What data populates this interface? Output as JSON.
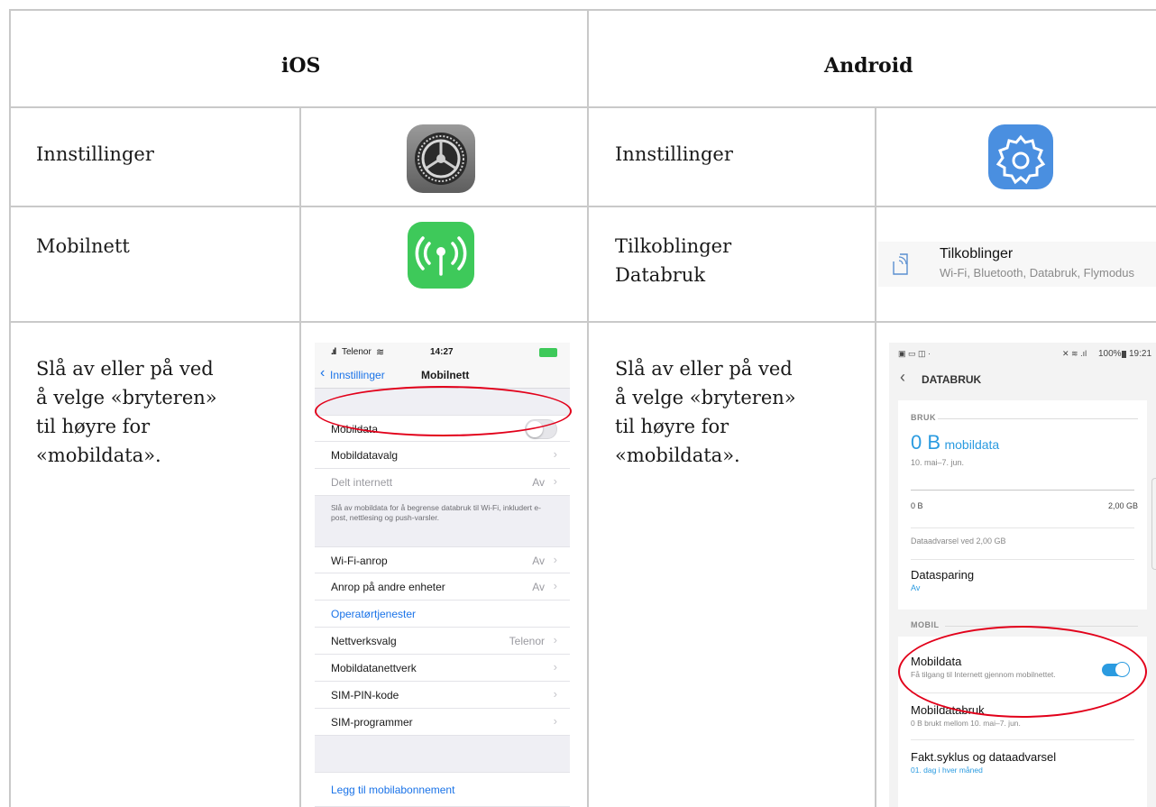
{
  "table": {
    "headers": {
      "ios": "iOS",
      "android": "Android"
    },
    "rows": {
      "settings": {
        "ios_label": "Innstillinger",
        "android_label": "Innstillinger"
      },
      "network": {
        "ios_label": "Mobilnett",
        "android_label_line1": "Tilkoblinger",
        "android_label_line2": "Databruk"
      },
      "toggle": {
        "ios_text": [
          "Slå av eller på ved",
          "å velge «bryteren»",
          "til høyre for",
          "«mobildata»."
        ],
        "android_text": [
          "Slå av eller på ved",
          "å velge «bryteren»",
          "til høyre for",
          "«mobildata»."
        ]
      }
    }
  },
  "android_connections_item": {
    "title": "Tilkoblinger",
    "subtitle": "Wi-Fi, Bluetooth, Databruk, Flymodus"
  },
  "ios_screen": {
    "carrier": "Telenor",
    "time": "14:27",
    "back_label": "Innstillinger",
    "title": "Mobilnett",
    "rows": [
      {
        "label": "Mobildata"
      },
      {
        "label": "Mobildatavalg"
      },
      {
        "label": "Delt internett",
        "value": "Av"
      }
    ],
    "note": "Slå av mobildata for å begrense databruk til Wi-Fi, inkludert e-post, nettlesing og push-varsler.",
    "rows2": [
      {
        "label": "Wi-Fi-anrop",
        "value": "Av"
      },
      {
        "label": "Anrop på andre enheter",
        "value": "Av"
      },
      {
        "label": "Operatørtjenester"
      },
      {
        "label": "Nettverksvalg",
        "value": "Telenor"
      },
      {
        "label": "Mobildatanettverk"
      },
      {
        "label": "SIM-PIN-kode"
      },
      {
        "label": "SIM-programmer"
      }
    ],
    "footer_link": "Legg til mobilabonnement",
    "link_color": "#1a73e8"
  },
  "android_screen": {
    "status_right": "100%",
    "time": "19:21",
    "title": "DATABRUK",
    "section_bruk": "BRUK",
    "usage_value": "0 B",
    "usage_unit": "mobildata",
    "usage_period": "10. mai–7. jun.",
    "bar_min": "0 B",
    "bar_max": "2,00 GB",
    "warning": "Dataadvarsel ved 2,00 GB",
    "datasparing_title": "Datasparing",
    "datasparing_value": "Av",
    "section_mobil": "MOBIL",
    "mobildata_title": "Mobildata",
    "mobildata_sub": "Få tilgang til Internett gjennom mobilnettet.",
    "mobildatabruk_title": "Mobildatabruk",
    "mobildatabruk_sub": "0 B brukt mellom 10. mai–7. jun.",
    "fakt_title": "Fakt.syklus og dataadvarsel",
    "fakt_sub": "01. dag i hver måned",
    "accent": "#2b9be0"
  },
  "colors": {
    "ios_green": "#3ec95a",
    "android_blue": "#4a8fe0",
    "highlight_red": "#e2001a",
    "grid": "#c9c9c9"
  },
  "icons": {
    "ios_settings": "gear-icon",
    "ios_cellular": "antenna-icon",
    "android_settings": "gear-icon",
    "android_connections": "connections-icon"
  }
}
